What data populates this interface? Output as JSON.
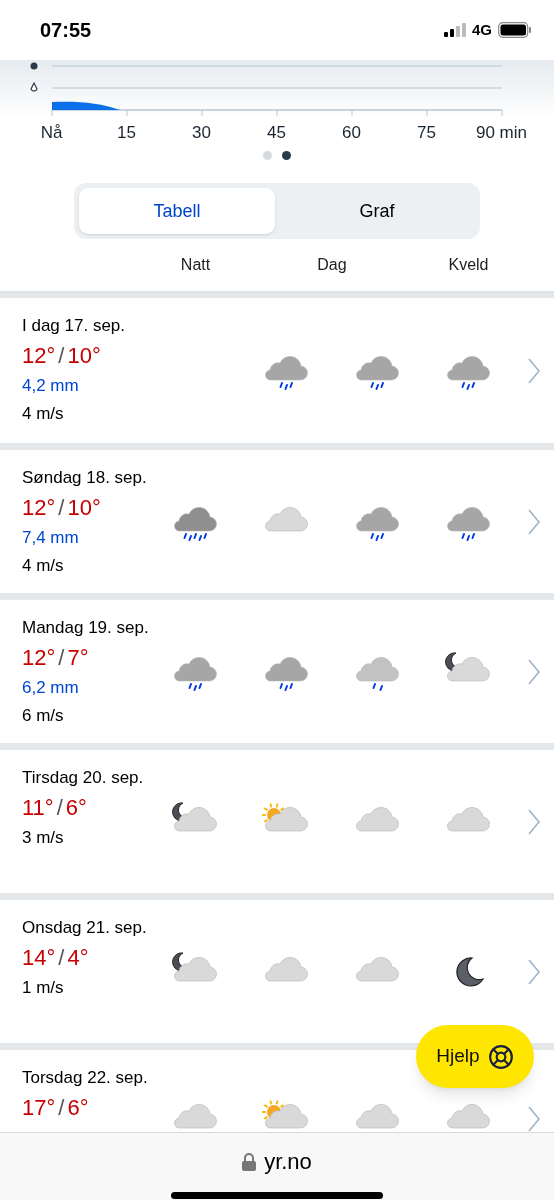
{
  "status_bar": {
    "time": "07:55",
    "network": "4G"
  },
  "precipitation_chart": {
    "axis_labels": [
      "Nå",
      "15",
      "30",
      "45",
      "60",
      "75",
      "90 min"
    ]
  },
  "pages": [
    {
      "selected": false
    },
    {
      "selected": true
    }
  ],
  "view_tabs": [
    {
      "label": "Tabell",
      "selected": true
    },
    {
      "label": "Graf",
      "selected": false
    }
  ],
  "column_headers": [
    {
      "label": "Natt",
      "kind": "single"
    },
    {
      "label": "Dag",
      "kind": "double"
    },
    {
      "label": "Kveld",
      "kind": "single"
    }
  ],
  "days": [
    {
      "date": "I dag 17. sep.",
      "high": "12°",
      "temp_separator": "/",
      "low": "10°",
      "precipitation": "4,2 mm",
      "wind": "4 m/s",
      "icons": [
        {
          "kind": "none"
        },
        {
          "kind": "rain"
        },
        {
          "kind": "rain"
        },
        {
          "kind": "rain"
        }
      ]
    },
    {
      "date": "Søndag 18. sep.",
      "high": "12°",
      "temp_separator": "/",
      "low": "10°",
      "precipitation": "7,4 mm",
      "wind": "4 m/s",
      "icons": [
        {
          "kind": "heavy-rain"
        },
        {
          "kind": "cloud"
        },
        {
          "kind": "rain"
        },
        {
          "kind": "rain"
        }
      ]
    },
    {
      "date": "Mandag 19. sep.",
      "high": "12°",
      "temp_separator": "/",
      "low": "7°",
      "precipitation": "6,2 mm",
      "wind": "6 m/s",
      "icons": [
        {
          "kind": "rain"
        },
        {
          "kind": "rain"
        },
        {
          "kind": "light-rain"
        },
        {
          "kind": "moon-cloud"
        }
      ]
    },
    {
      "date": "Tirsdag 20. sep.",
      "high": "11°",
      "temp_separator": "/",
      "low": "6°",
      "wind": "3 m/s",
      "icons": [
        {
          "kind": "moon-cloud"
        },
        {
          "kind": "sun-cloud"
        },
        {
          "kind": "cloud"
        },
        {
          "kind": "cloud"
        }
      ]
    },
    {
      "date": "Onsdag 21. sep.",
      "high": "14°",
      "temp_separator": "/",
      "low": "4°",
      "wind": "1 m/s",
      "icons": [
        {
          "kind": "moon-cloud"
        },
        {
          "kind": "cloud"
        },
        {
          "kind": "cloud"
        },
        {
          "kind": "moon"
        }
      ]
    },
    {
      "date": "Torsdag 22. sep.",
      "high": "17°",
      "temp_separator": "/",
      "low": "6°",
      "icons": [
        {
          "kind": "cloud"
        },
        {
          "kind": "sun-cloud"
        },
        {
          "kind": "cloud"
        },
        {
          "kind": "cloud"
        }
      ]
    }
  ],
  "help_button": {
    "label": "Hjelp"
  },
  "url_bar": {
    "url": "yr.no"
  }
}
